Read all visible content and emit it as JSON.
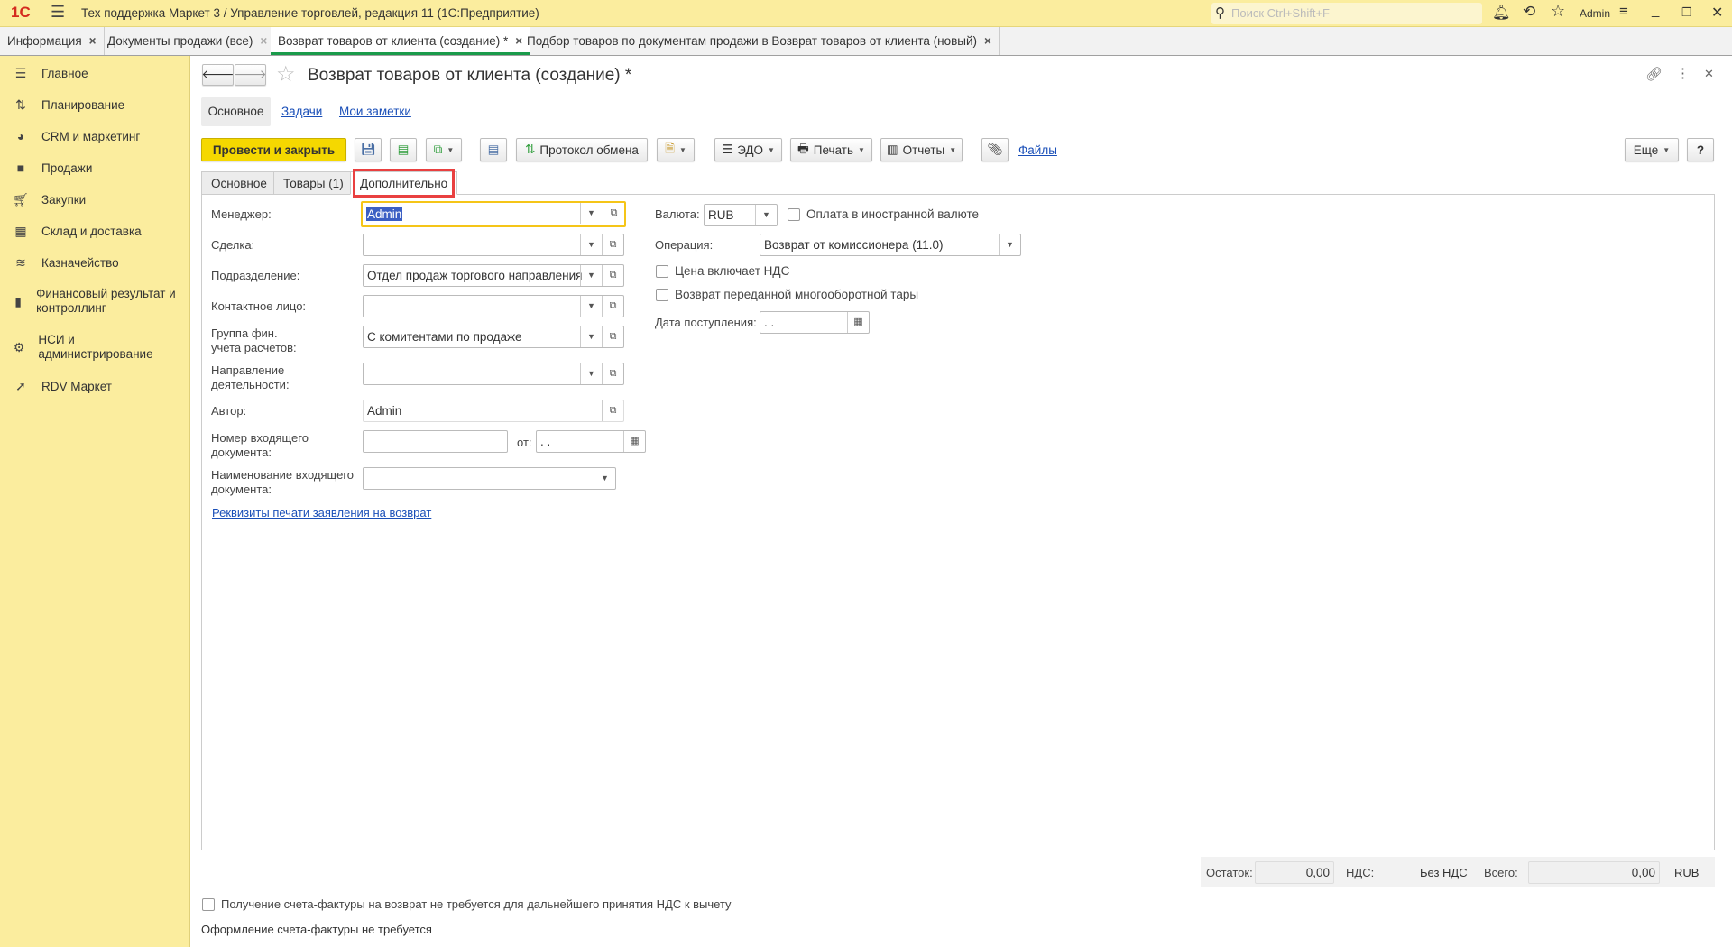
{
  "app": {
    "logo": "1С",
    "title": "Тех поддержка Маркет 3 / Управление торговлей, редакция 11  (1С:Предприятие)",
    "search_placeholder": "Поиск Ctrl+Shift+F",
    "user": "Admin"
  },
  "window_tabs": [
    {
      "label": "Информация"
    },
    {
      "label": "Документы продажи (все)"
    },
    {
      "label": "Возврат товаров от клиента (создание) *",
      "active": true
    },
    {
      "label": "Подбор товаров по документам продажи в Возврат товаров от клиента (новый)"
    }
  ],
  "sidebar": {
    "items": [
      {
        "label": "Главное",
        "icon": "menu-icon"
      },
      {
        "label": "Планирование",
        "icon": "planning-icon"
      },
      {
        "label": "CRM и маркетинг",
        "icon": "pie-chart-icon"
      },
      {
        "label": "Продажи",
        "icon": "shopping-bag-icon"
      },
      {
        "label": "Закупки",
        "icon": "cart-icon"
      },
      {
        "label": "Склад и доставка",
        "icon": "warehouse-icon"
      },
      {
        "label": "Казначейство",
        "icon": "coins-icon"
      },
      {
        "label": "Финансовый результат и контроллинг",
        "icon": "bar-chart-icon"
      },
      {
        "label": "НСИ и администрирование",
        "icon": "gear-icon"
      },
      {
        "label": "RDV Маркет",
        "icon": "rocket-icon"
      }
    ]
  },
  "document": {
    "title": "Возврат товаров от клиента (создание) *",
    "subtabs": [
      "Основное",
      "Задачи",
      "Мои заметки"
    ],
    "toolbar": {
      "post_close": "Провести и закрыть",
      "exchange_log": "Протокол обмена",
      "edo": "ЭДО",
      "print": "Печать",
      "reports": "Отчеты",
      "files": "Файлы",
      "more": "Еще",
      "help": "?"
    },
    "form_tabs": [
      "Основное",
      "Товары (1)",
      "Дополнительно"
    ],
    "fields": {
      "manager": {
        "label": "Менеджер:",
        "value": "Admin"
      },
      "deal": {
        "label": "Сделка:",
        "value": ""
      },
      "department": {
        "label": "Подразделение:",
        "value": "Отдел продаж торгового направления"
      },
      "contact": {
        "label": "Контактное лицо:",
        "value": ""
      },
      "fin_group": {
        "label": "Группа фин. учета расчетов:",
        "label1": "Группа фин.",
        "label2": "учета расчетов:",
        "value": "С комитентами по продаже"
      },
      "activity": {
        "label1": "Направление",
        "label2": "деятельности:",
        "value": ""
      },
      "author": {
        "label": "Автор:",
        "value": "Admin"
      },
      "incoming_number": {
        "label1": "Номер входящего",
        "label2": "документа:",
        "value": "",
        "from_label": "от:",
        "date": " .  ."
      },
      "incoming_name": {
        "label1": "Наименование входящего",
        "label2": "документа:",
        "value": ""
      },
      "print_link": "Реквизиты печати заявления на возврат",
      "currency": {
        "label": "Валюта:",
        "value": "RUB"
      },
      "foreign_payment": {
        "label": "Оплата в иностранной валюте",
        "checked": false
      },
      "operation": {
        "label": "Операция:",
        "value": "Возврат от комиссионера (11.0)"
      },
      "price_incl_vat": {
        "label": "Цена включает НДС",
        "checked": false
      },
      "returnable_tare": {
        "label": "Возврат переданной многооборотной тары",
        "checked": false
      },
      "receipt_date": {
        "label": "Дата поступления:",
        "value": " .  ."
      }
    },
    "totals": {
      "balance_label": "Остаток:",
      "balance": "0,00",
      "vat_label": "НДС:",
      "vat": "Без НДС",
      "total_label": "Всего:",
      "total": "0,00",
      "currency": "RUB"
    },
    "invoice_checkbox": {
      "label": "Получение счета-фактуры на возврат не требуется для дальнейшего принятия НДС к вычету",
      "checked": false
    },
    "invoice_note": "Оформление счета-фактуры не требуется"
  },
  "colors": {
    "accent_yellow": "#f5d800",
    "title_bg": "#fbed9e",
    "link": "#1a4fb8",
    "highlight": "#e94040"
  }
}
